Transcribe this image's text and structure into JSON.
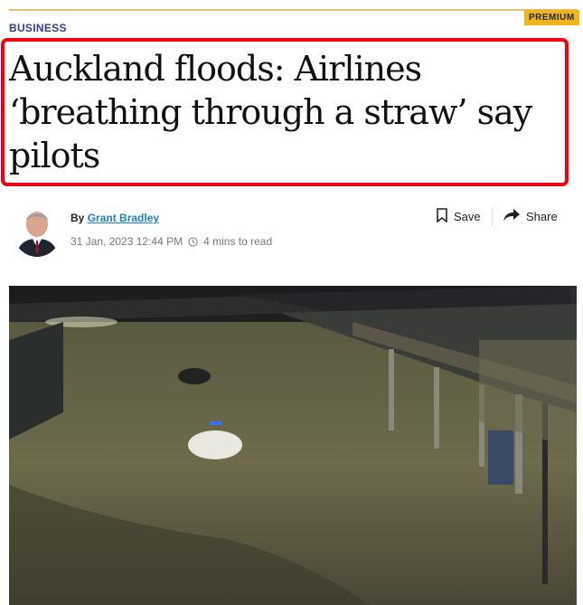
{
  "article": {
    "premium_label": "PREMIUM",
    "section": "BUSINESS",
    "headline": "Auckland floods: Airlines ‘breathing through a straw’ say pilots",
    "byline_prefix": "By",
    "author": "Grant Bradley",
    "timestamp": "31 Jan, 2023 12:44 PM",
    "read_time": "4 mins to read"
  },
  "actions": {
    "save_label": "Save",
    "share_label": "Share"
  },
  "colors": {
    "premium_bg": "#f0b51a",
    "section": "#3a3a8c",
    "highlight_border": "#f00010",
    "author_link": "#1a7fc1"
  },
  "icons": {
    "save": "bookmark-icon",
    "share": "share-arrow-icon",
    "time": "clock-icon"
  }
}
